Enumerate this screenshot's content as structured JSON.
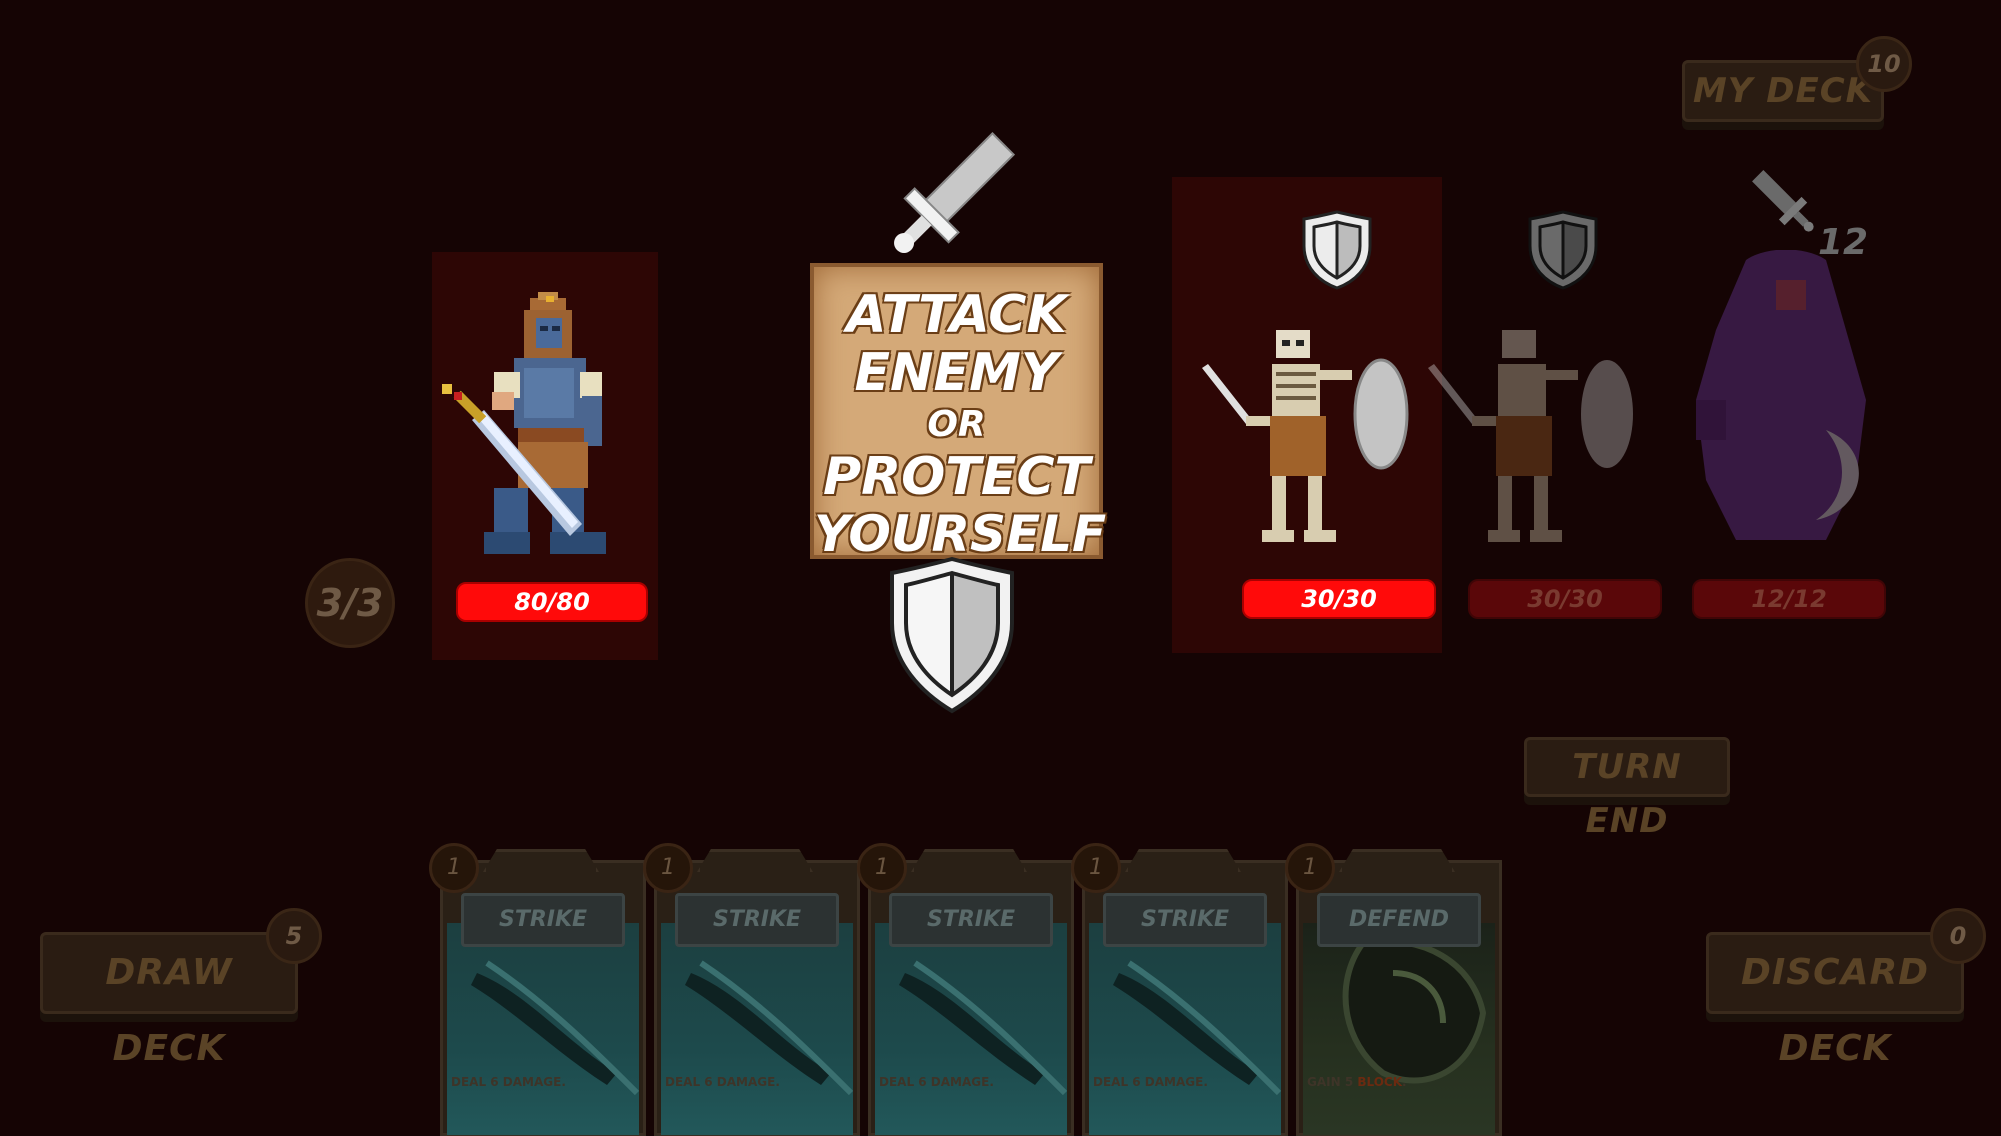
{
  "header": {
    "my_deck_label": "MY DECK",
    "my_deck_count": "10"
  },
  "player": {
    "hp": "80/80",
    "energy": "3/3"
  },
  "tutorial_sign": {
    "line1": "ATTACK",
    "line2": "ENEMY",
    "line3": "OR",
    "line4": "PROTECT",
    "line5": "YOURSELF"
  },
  "enemies": [
    {
      "name": "skeleton",
      "hp": "30/30",
      "intent": "shield-icon",
      "selected": true
    },
    {
      "name": "skeleton",
      "hp": "30/30",
      "intent": "shield-icon",
      "selected": false
    },
    {
      "name": "wraith",
      "hp": "12/12",
      "intent": "sword-icon",
      "intent_value": "12",
      "selected": false
    }
  ],
  "buttons": {
    "turn_end": "TURN END",
    "draw_deck": "DRAW DECK",
    "draw_deck_count": "5",
    "discard_deck": "DISCARD DECK",
    "discard_deck_count": "0"
  },
  "hand": [
    {
      "cost": "1",
      "title": "STRIKE",
      "desc": "DEAL 6 DAMAGE."
    },
    {
      "cost": "1",
      "title": "STRIKE",
      "desc": "DEAL 6 DAMAGE."
    },
    {
      "cost": "1",
      "title": "STRIKE",
      "desc": "DEAL 6 DAMAGE."
    },
    {
      "cost": "1",
      "title": "STRIKE",
      "desc": "DEAL 6 DAMAGE."
    },
    {
      "cost": "1",
      "title": "DEFEND",
      "desc_prefix": "GAIN 5 ",
      "desc_keyword": "BLOCK",
      "desc_suffix": "."
    }
  ],
  "colors": {
    "background": "#150404",
    "hp_active": "#ff0a0a",
    "hp_dim": "#5a0709",
    "sign": "#d4a978"
  }
}
